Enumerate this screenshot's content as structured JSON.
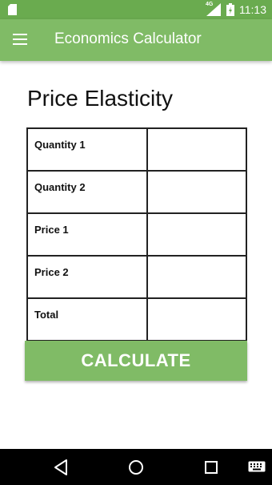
{
  "status_bar": {
    "time": "11:13",
    "network": "4G",
    "icons": [
      "sd-card-icon",
      "signal-icon",
      "battery-icon"
    ]
  },
  "toolbar": {
    "title": "Economics Calculator",
    "menu_icon": "hamburger-menu-icon",
    "color": "#80bb66"
  },
  "main": {
    "heading": "Price Elasticity",
    "rows": [
      {
        "label": "Quantity 1",
        "value": ""
      },
      {
        "label": "Quantity 2",
        "value": ""
      },
      {
        "label": "Price 1",
        "value": ""
      },
      {
        "label": "Price 2",
        "value": ""
      },
      {
        "label": "Total",
        "value": ""
      }
    ],
    "button_label": "CALCULATE"
  },
  "nav_bar": {
    "icons": [
      "back-icon",
      "home-icon",
      "recents-icon",
      "keyboard-icon"
    ]
  }
}
